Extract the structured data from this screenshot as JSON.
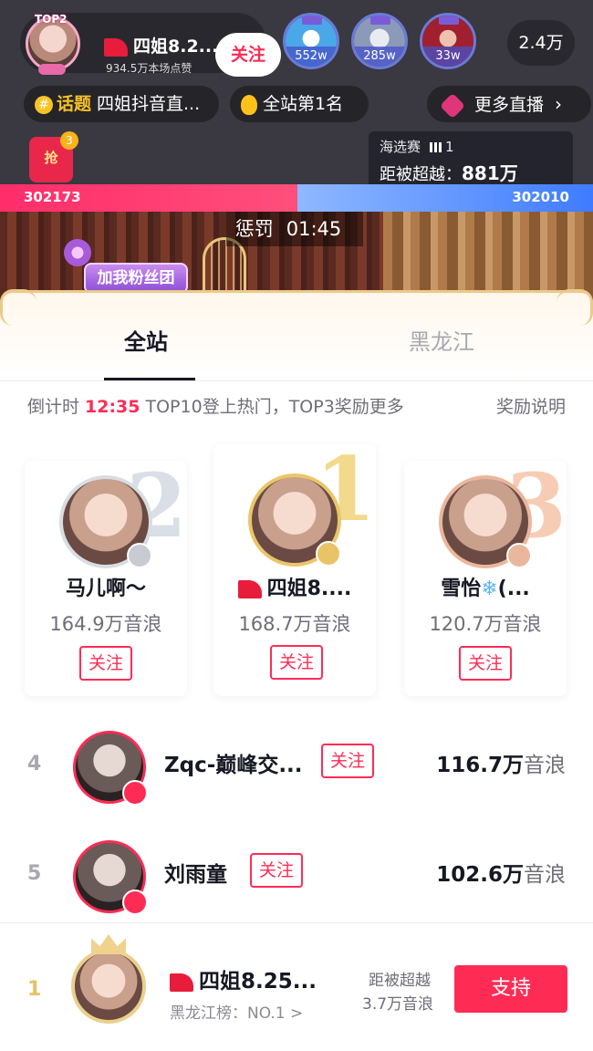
{
  "live_header": {
    "top_badge": "TOP2",
    "host_name": "四姐8.2...",
    "host_likes": "934.5万本场点赞",
    "follow_label": "关注",
    "viewers": [
      {
        "count": "552w",
        "color": "#4aa8e8"
      },
      {
        "count": "285w",
        "color": "#8a9ab8"
      },
      {
        "count": "33w",
        "color": "#a02030"
      }
    ],
    "viewer_total": "2.4万"
  },
  "pills": {
    "topic_key": "话题",
    "topic_text": "四姐抖音直...",
    "site_rank": "全站第1名",
    "more_live": "更多直播"
  },
  "pk": {
    "grab_label": "抢",
    "grab_badge": "3",
    "round_label": "海选赛",
    "round_value": "1",
    "gap_label": "距被超越：",
    "gap_value": "881万",
    "left_score": "302173",
    "right_score": "302010",
    "left_color": "#ff2d6a",
    "right_color": "#3e7bff"
  },
  "stage": {
    "penalty_label": "惩罚",
    "penalty_time": "01:45",
    "fan_button": "加我粉丝团"
  },
  "tabs": {
    "all": "全站",
    "province": "黑龙江"
  },
  "countdown": {
    "prefix": "倒计时",
    "time": "12:35",
    "suffix": "TOP10登上热门，TOP3奖励更多",
    "reward_link": "奖励说明"
  },
  "podium": [
    {
      "numeral": "2",
      "name": "马儿啊～",
      "score": "164.9万音浪",
      "follow": "关注",
      "numeral_color": "#d8dfe6"
    },
    {
      "numeral": "1",
      "name": "四姐8....",
      "score": "168.7万音浪",
      "follow": "关注",
      "numeral_color": "#f3d98c"
    },
    {
      "numeral": "3",
      "name": "雪怡",
      "name_suffix": "(...",
      "score": "120.7万音浪",
      "follow": "关注",
      "numeral_color": "#f6cdb4"
    }
  ],
  "rows": [
    {
      "rank": "4",
      "name": "Zqc-巅峰交...",
      "follow": "关注",
      "score_value": "116.7万",
      "score_unit": "音浪"
    },
    {
      "rank": "5",
      "name": "刘雨童",
      "follow": "关注",
      "score_value": "102.6万",
      "score_unit": "音浪"
    }
  ],
  "bottom": {
    "rank": "1",
    "name": "四姐8.25...",
    "sub": "黑龙江榜：NO.1 >",
    "gap_line1": "距被超越",
    "gap_line2": "3.7万音浪",
    "support": "支持"
  },
  "icons": {
    "snowflake": "❄",
    "chevron": "›"
  }
}
